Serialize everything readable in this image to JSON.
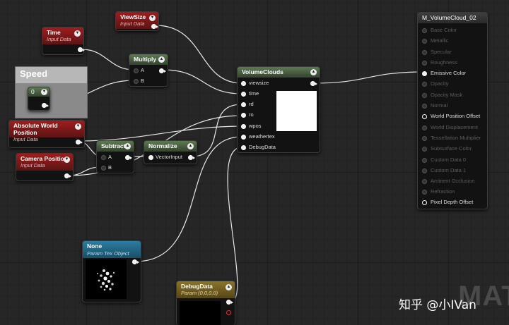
{
  "nodes": {
    "viewsize": {
      "title": "ViewSize",
      "subtitle": "Input Data"
    },
    "time": {
      "title": "Time",
      "subtitle": "Input Data"
    },
    "multiply": {
      "title": "Multiply",
      "pin_a": "A",
      "pin_b": "B"
    },
    "speed_comment": {
      "title": "Speed"
    },
    "speed_const": {
      "value": "0"
    },
    "abs_world_pos": {
      "title": "Absolute World Position",
      "subtitle": "Input Data"
    },
    "camera_pos": {
      "title": "Camera Position",
      "subtitle": "Input Data"
    },
    "subtract": {
      "title": "Subtract",
      "pin_a": "A",
      "pin_b": "B"
    },
    "normalize": {
      "title": "Normalize",
      "pin_in": "VectorInput"
    },
    "volumeclouds": {
      "title": "VolumeClouds",
      "pins": [
        "viewsize",
        "time",
        "rd",
        "ro",
        "wpos",
        "weathertex",
        "DebugData"
      ]
    },
    "texture": {
      "title": "None",
      "subtitle": "Param Tex Object"
    },
    "debugdata": {
      "title": "DebugData",
      "subtitle": "Param (0,0,0,0)"
    },
    "material": {
      "title": "M_VolumeCloud_02",
      "pins": [
        {
          "label": "Base Color",
          "active": false
        },
        {
          "label": "Metallic",
          "active": false
        },
        {
          "label": "Specular",
          "active": false
        },
        {
          "label": "Roughness",
          "active": false
        },
        {
          "label": "Emissive Color",
          "active": true
        },
        {
          "label": "Opacity",
          "active": false
        },
        {
          "label": "Opacity Mask",
          "active": false
        },
        {
          "label": "Normal",
          "active": false
        },
        {
          "label": "World Position Offset",
          "active": true
        },
        {
          "label": "World Displacement",
          "active": false
        },
        {
          "label": "Tessellation Multiplier",
          "active": false
        },
        {
          "label": "Subsurface Color",
          "active": false
        },
        {
          "label": "Custom Data 0",
          "active": false
        },
        {
          "label": "Custom Data 1",
          "active": false
        },
        {
          "label": "Ambient Occlusion",
          "active": false
        },
        {
          "label": "Refraction",
          "active": false
        },
        {
          "label": "Pixel Depth Offset",
          "active": true
        }
      ]
    }
  },
  "watermark": "知乎 @小IVan",
  "background_label": "MAT",
  "colors": {
    "input_header": "#8e1a1a",
    "math_header": "#4f6a45",
    "texture_header": "#2b7ea0",
    "param_header": "#8a7526",
    "wire": "#e8e8e8",
    "canvas": "#262626"
  }
}
